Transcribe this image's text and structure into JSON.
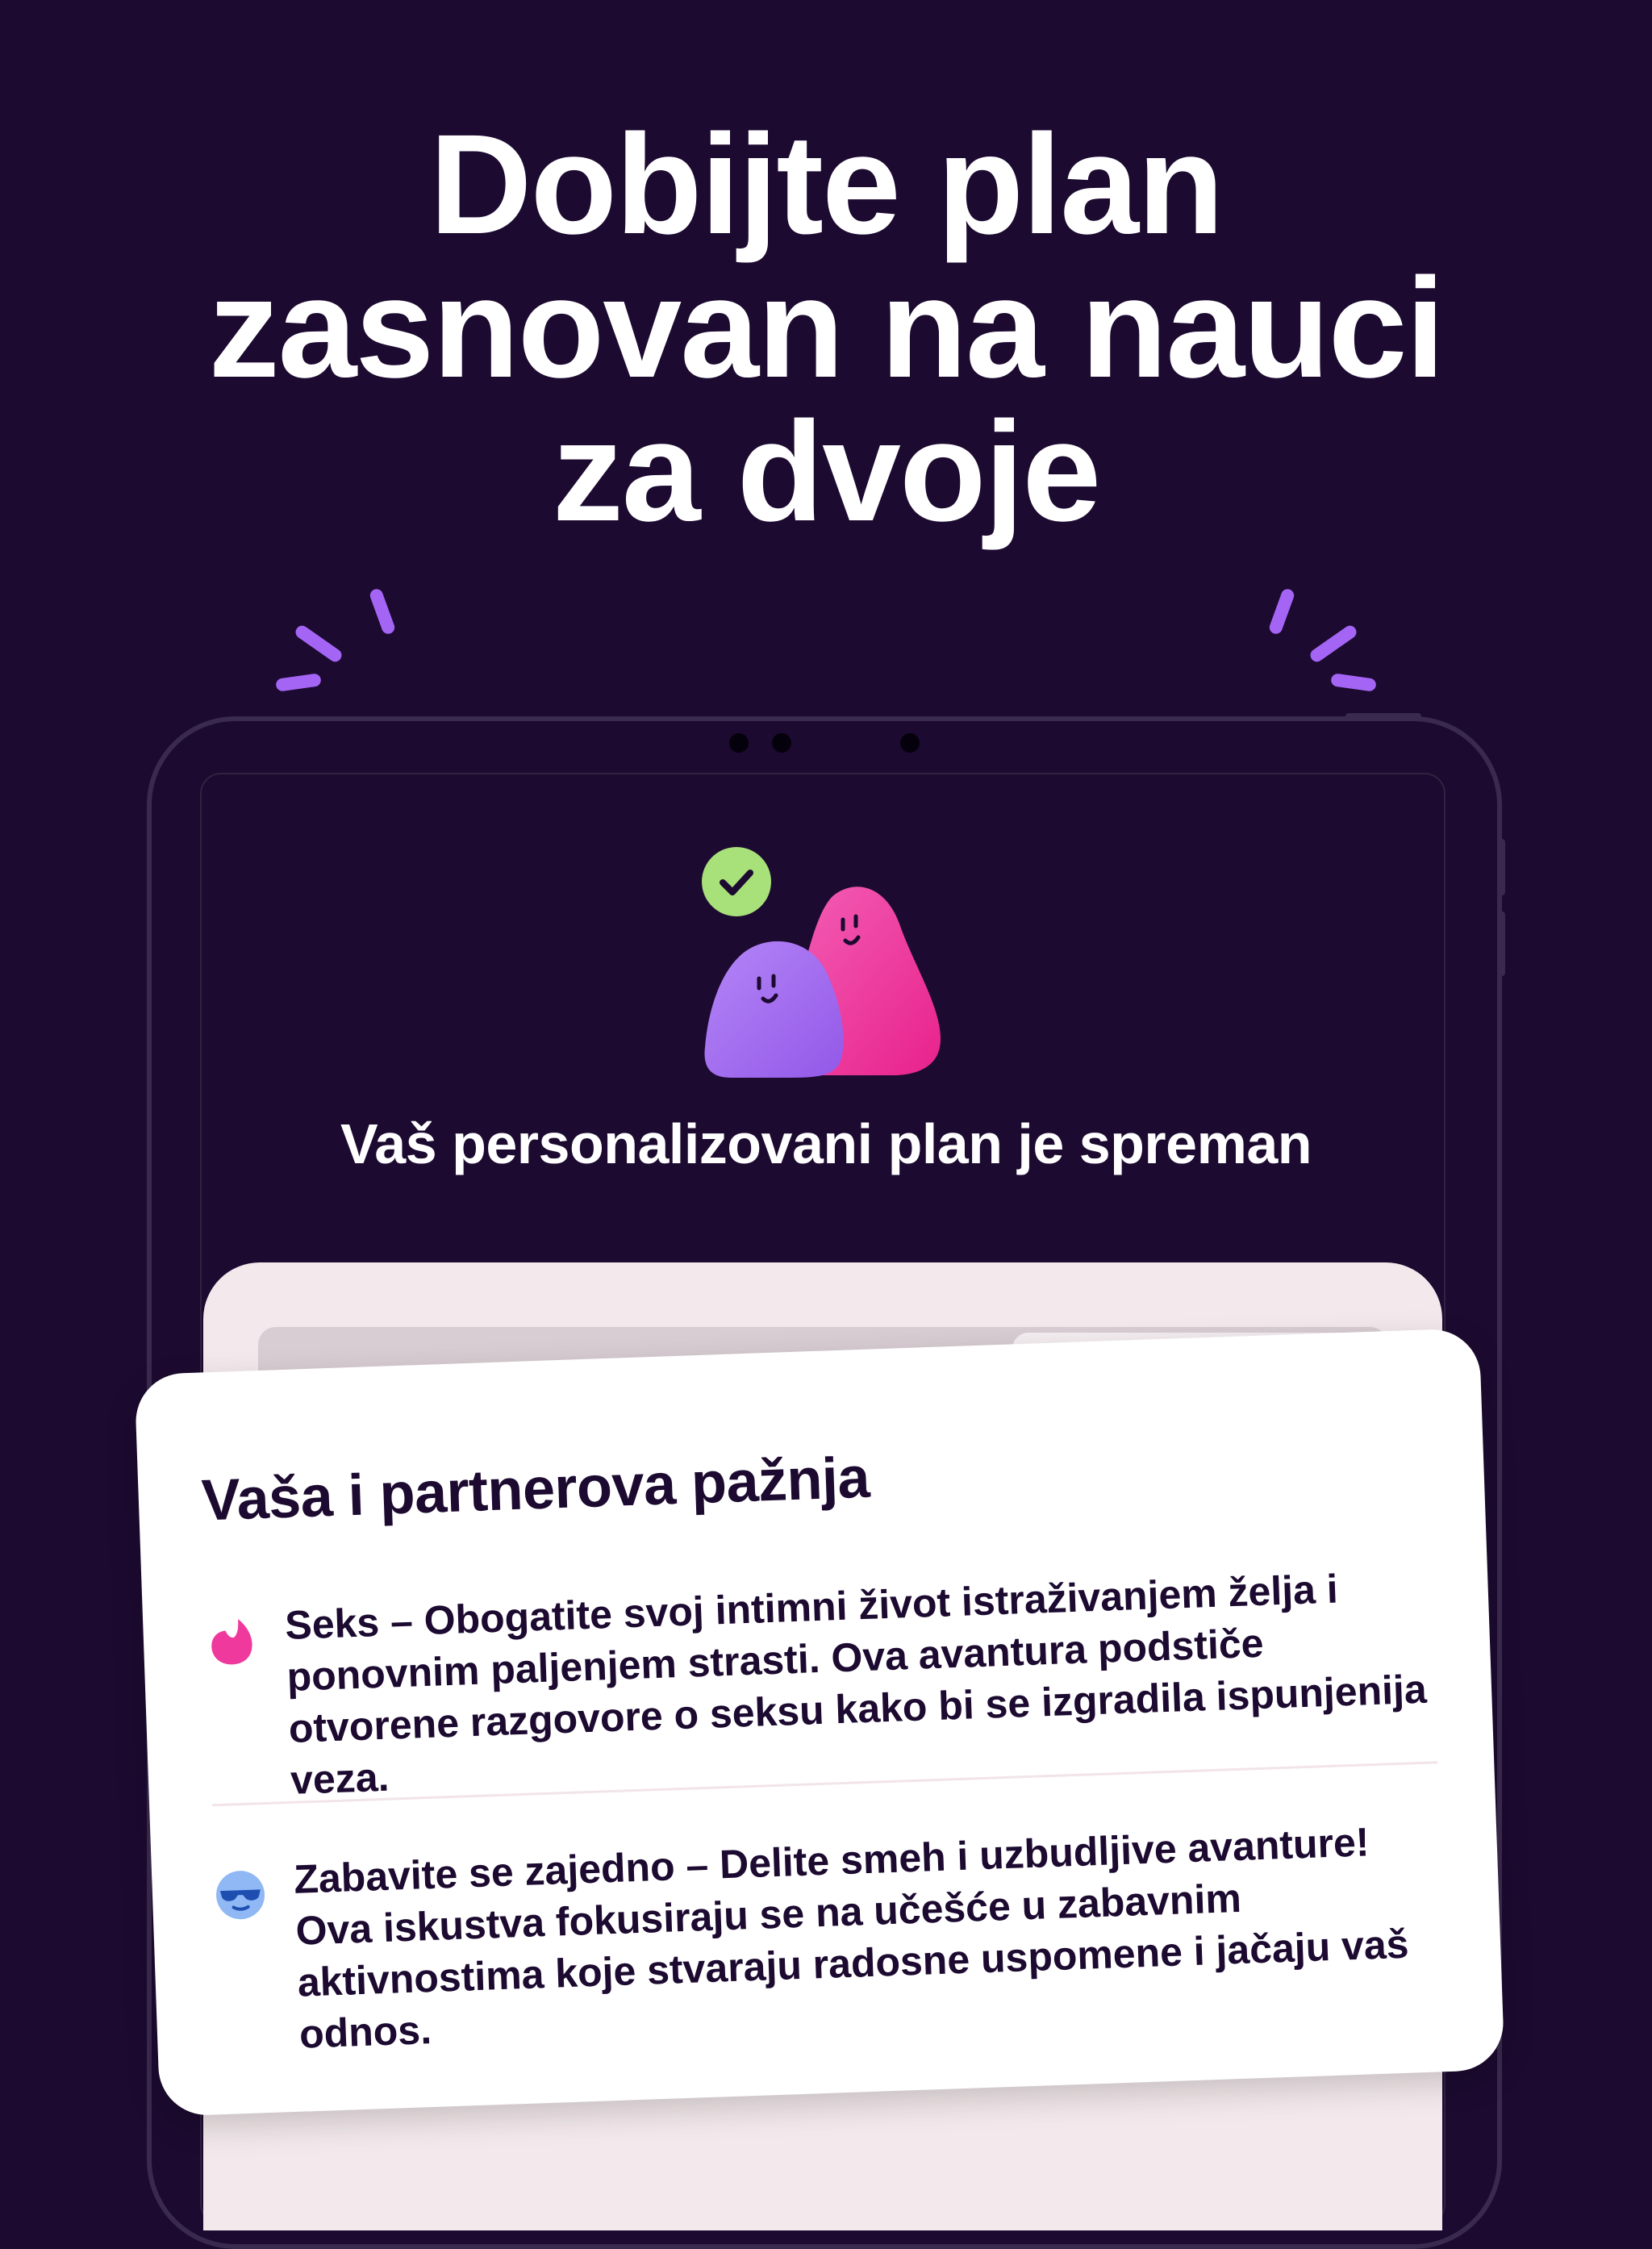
{
  "headline": {
    "line1": "Dobijte plan",
    "line2": "zasnovan na nauci",
    "line3": "za dvoje"
  },
  "screen": {
    "ready_text": "Vaš personalizovani plan je spreman"
  },
  "card": {
    "title": "Vaša i partnerova pažnja",
    "items": [
      {
        "icon": "flame-icon",
        "text": "Seks – Obogatite svoj intimni život istraživanjem želja i ponovnim paljenjem strasti. Ova avantura podstiče otvorene razgovore o seksu kako bi se izgradila ispunjenija veza."
      },
      {
        "icon": "sunglasses-face-icon",
        "text": "Zabavite se zajedno – Delite smeh i uzbudljive avanture! Ova iskustva fokusiraju se na učešće u zabavnim aktivnostima koje stvaraju radosne uspomene i jačaju vaš odnos."
      }
    ]
  },
  "colors": {
    "background": "#1c0a30",
    "accent_purple": "#a465f5",
    "accent_pink": "#f0399c",
    "check_green": "#a8e07a",
    "card_bg": "#ffffff",
    "text_dark": "#1c0a30"
  }
}
